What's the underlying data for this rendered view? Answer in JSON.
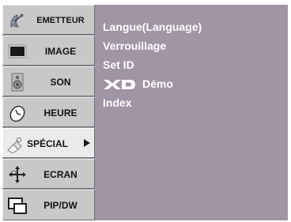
{
  "sidebar": {
    "items": [
      {
        "label": "EMETTEUR",
        "icon": "satellite-dish-icon"
      },
      {
        "label": "IMAGE",
        "icon": "monitor-screen-icon"
      },
      {
        "label": "SON",
        "icon": "speaker-icon"
      },
      {
        "label": "HEURE",
        "icon": "clock-icon"
      },
      {
        "label": "SPÉCIAL",
        "icon": "tag-icon",
        "selected": true
      },
      {
        "label": "ECRAN",
        "icon": "move-arrows-icon"
      },
      {
        "label": "PIP/DW",
        "icon": "picture-in-picture-icon"
      }
    ]
  },
  "submenu": {
    "items": [
      {
        "label": "Langue(Language)"
      },
      {
        "label": "Verrouillage"
      },
      {
        "label": "Set ID"
      },
      {
        "label": "Démo",
        "logo_text": "XD"
      },
      {
        "label": "Index"
      }
    ]
  },
  "colors": {
    "panel_background": "#a094a5",
    "menu_item_background": "#c8c8c8",
    "menu_item_active_background": "#ebebeb",
    "submenu_text": "#ffffff"
  }
}
